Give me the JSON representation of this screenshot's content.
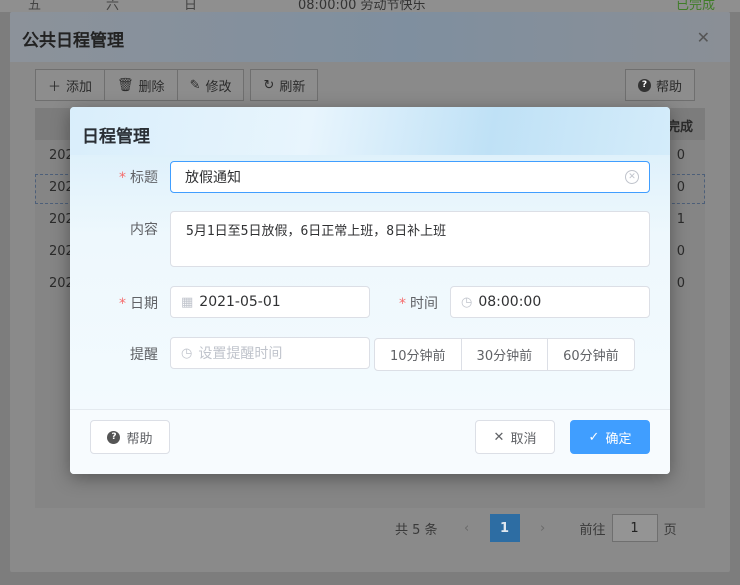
{
  "background": {
    "weekdays": [
      "五",
      "六",
      "日"
    ],
    "event_text": "08:00:00 劳动节快乐",
    "status_text": "已完成"
  },
  "outer_dialog": {
    "title": "公共日程管理",
    "close_icon": "close-icon",
    "toolbar": {
      "add": "添加",
      "delete": "删除",
      "edit": "修改",
      "refresh": "刷新",
      "help": "帮助"
    },
    "table": {
      "last_header": "完成",
      "rows": [
        {
          "left": "202",
          "right": "0"
        },
        {
          "left": "202",
          "right": "0"
        },
        {
          "left": "202",
          "right": "1"
        },
        {
          "left": "202",
          "right": "0"
        },
        {
          "left": "202",
          "right": "0"
        }
      ]
    },
    "pager": {
      "total": "共 5 条",
      "current_page": "1",
      "goto_label": "前往",
      "goto_value": "1",
      "page_suffix": "页"
    }
  },
  "modal": {
    "title": "日程管理",
    "fields": {
      "title_label": "标题",
      "title_value": "放假通知",
      "content_label": "内容",
      "content_value": "5月1日至5日放假，6日正常上班，8日补上班",
      "date_label": "日期",
      "date_value": "2021-05-01",
      "time_label": "时间",
      "time_value": "08:00:00",
      "remind_label": "提醒",
      "remind_placeholder": "设置提醒时间"
    },
    "remind_options": [
      "10分钟前",
      "30分钟前",
      "60分钟前"
    ],
    "footer": {
      "help": "帮助",
      "cancel": "取消",
      "confirm": "确定"
    }
  },
  "colors": {
    "primary": "#409eff",
    "required": "#f56c6c"
  }
}
